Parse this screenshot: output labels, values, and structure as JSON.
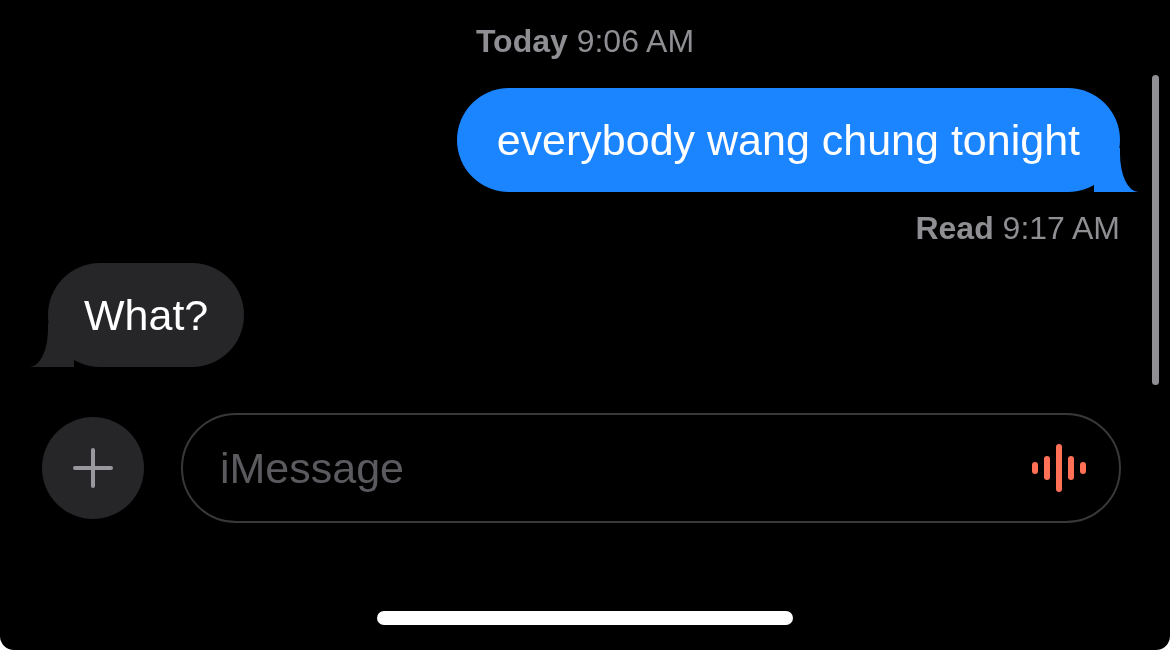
{
  "thread": [
    {
      "kind": "timestamp",
      "text": "**Today** 9:06 AM"
    },
    {
      "kind": "sent",
      "text": "everybody wang chung tonight"
    },
    {
      "kind": "receipt",
      "text": "**Read** 9:17 AM"
    },
    {
      "kind": "received",
      "text": "What?"
    }
  ],
  "composer": {
    "placeholder": "iMessage"
  }
}
